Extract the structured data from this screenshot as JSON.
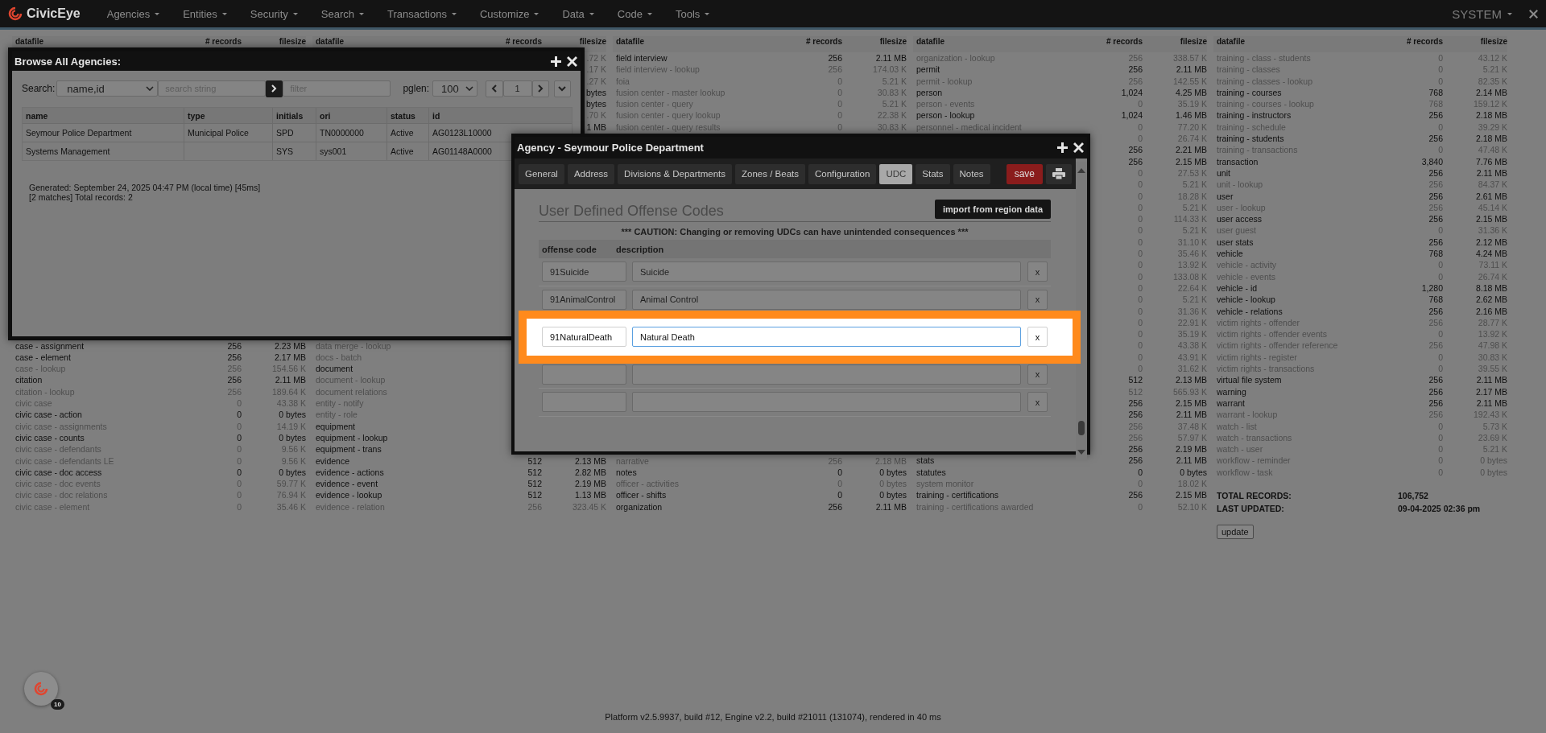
{
  "nav": {
    "logo": "CivicEye",
    "menus": [
      {
        "label": "Agencies"
      },
      {
        "label": "Entities"
      },
      {
        "label": "Security"
      },
      {
        "label": "Search"
      },
      {
        "label": "Transactions"
      },
      {
        "label": "Customize"
      },
      {
        "label": "Data"
      },
      {
        "label": "Code"
      },
      {
        "label": "Tools"
      }
    ],
    "user": "SYSTEM"
  },
  "datafile_columns": [
    {
      "kind": "partial",
      "headers": [
        "datafile",
        "# records",
        "filesize"
      ],
      "blocks": [
        {
          "rows": [
            {
              "datafile": "case - assignment",
              "records": "256",
              "filesize": "2.23 MB",
              "dim": false
            },
            {
              "datafile": "case - element",
              "records": "256",
              "filesize": "2.17 MB",
              "dim": false
            },
            {
              "datafile": "case - lookup",
              "records": "256",
              "filesize": "154.56 K",
              "dim": true
            },
            {
              "datafile": "citation",
              "records": "256",
              "filesize": "2.11 MB",
              "dim": false
            },
            {
              "datafile": "citation - lookup",
              "records": "256",
              "filesize": "189.64 K",
              "dim": true
            },
            {
              "datafile": "civic case",
              "records": "0",
              "filesize": "43.38 K",
              "dim": true
            },
            {
              "datafile": "civic case - action",
              "records": "0",
              "filesize": "0 bytes",
              "dim": false
            },
            {
              "datafile": "civic case - assignments",
              "records": "0",
              "filesize": "14.19 K",
              "dim": true
            },
            {
              "datafile": "civic case - counts",
              "records": "0",
              "filesize": "0 bytes",
              "dim": false
            },
            {
              "datafile": "civic case - defendants",
              "records": "0",
              "filesize": "9.56 K",
              "dim": true
            },
            {
              "datafile": "civic case - defendants LE",
              "records": "0",
              "filesize": "9.56 K",
              "dim": true
            },
            {
              "datafile": "civic case - doc access",
              "records": "0",
              "filesize": "0 bytes",
              "dim": false
            },
            {
              "datafile": "civic case - doc events",
              "records": "0",
              "filesize": "59.77 K",
              "dim": true
            },
            {
              "datafile": "civic case - doc relations",
              "records": "0",
              "filesize": "76.94 K",
              "dim": true
            },
            {
              "datafile": "civic case - element",
              "records": "0",
              "filesize": "35.46 K",
              "dim": true
            }
          ]
        }
      ]
    },
    {
      "kind": "partial",
      "headers": [
        "datafile",
        "# records",
        "filesize"
      ],
      "blocks": [
        {
          "rows": [
            {
              "filesize": ".72 K",
              "dim": true
            },
            {
              "filesize": ".17 K",
              "dim": true
            },
            {
              "filesize": ".27 K",
              "dim": true
            },
            {
              "filesize": "bytes",
              "dim": false
            },
            {
              "filesize": "bytes",
              "dim": false
            },
            {
              "filesize": ".70 K",
              "dim": true
            },
            {
              "filesize": "1 MB",
              "dim": false
            }
          ]
        },
        {
          "rows": [
            {
              "datafile": "data merge - lookup",
              "dim": true
            },
            {
              "datafile": "docs - batch",
              "dim": true
            },
            {
              "datafile": "document",
              "dim": false
            },
            {
              "datafile": "document - lookup",
              "dim": true
            },
            {
              "datafile": "document relations",
              "dim": true
            },
            {
              "datafile": "entity - notify",
              "dim": true
            },
            {
              "datafile": "entity - role",
              "dim": true
            },
            {
              "datafile": "equipment",
              "dim": false
            },
            {
              "datafile": "equipment - lookup",
              "dim": false
            },
            {
              "datafile": "equipment - trans",
              "dim": false
            },
            {
              "datafile": "evidence",
              "records": "512",
              "filesize": "2.13 MB",
              "dim": false
            },
            {
              "datafile": "evidence - actions",
              "records": "512",
              "filesize": "2.82 MB",
              "dim": false
            },
            {
              "datafile": "evidence - event",
              "records": "512",
              "filesize": "2.19 MB",
              "dim": false
            },
            {
              "datafile": "evidence - lookup",
              "records": "512",
              "filesize": "1.13 MB",
              "dim": false
            },
            {
              "datafile": "evidence - relation",
              "records": "256",
              "filesize": "323.45 K",
              "dim": true
            }
          ]
        }
      ]
    },
    {
      "kind": "partial",
      "headers": [
        "datafile",
        "# records",
        "filesize"
      ],
      "blocks": [
        {
          "rows": [
            {
              "datafile": "field interview",
              "records": "256",
              "filesize": "2.11 MB",
              "dim": false
            },
            {
              "datafile": "field interview - lookup",
              "records": "256",
              "filesize": "174.03 K",
              "dim": true
            },
            {
              "datafile": "foia",
              "records": "0",
              "filesize": "5.21 K",
              "dim": true
            },
            {
              "datafile": "fusion center - master lookup",
              "records": "0",
              "filesize": "30.83 K",
              "dim": true
            },
            {
              "datafile": "fusion center - query",
              "records": "0",
              "filesize": "5.21 K",
              "dim": true
            },
            {
              "datafile": "fusion center - query lookup",
              "records": "0",
              "filesize": "22.38 K",
              "dim": true
            },
            {
              "datafile": "fusion center - query results",
              "records": "0",
              "filesize": "30.83 K",
              "dim": true
            }
          ]
        },
        {
          "rows": [
            {
              "datafile": "narrative",
              "records": "256",
              "filesize": "2.18 MB",
              "dim": true
            },
            {
              "datafile": "notes",
              "records": "0",
              "filesize": "0 bytes",
              "dim": false
            },
            {
              "datafile": "officer - activities",
              "records": "0",
              "filesize": "0 bytes",
              "dim": true
            },
            {
              "datafile": "officer - shifts",
              "records": "0",
              "filesize": "0 bytes",
              "dim": false
            },
            {
              "datafile": "organization",
              "records": "256",
              "filesize": "2.11 MB",
              "dim": false
            }
          ]
        }
      ]
    },
    {
      "kind": "full",
      "headers": [
        "datafile",
        "# records",
        "filesize"
      ],
      "blocks": [
        {
          "rows": [
            {
              "datafile": "organization - lookup",
              "records": "256",
              "filesize": "338.57 K",
              "dim": true
            },
            {
              "datafile": "permit",
              "records": "256",
              "filesize": "2.11 MB",
              "dim": false
            },
            {
              "datafile": "permit - lookup",
              "records": "256",
              "filesize": "142.55 K",
              "dim": true
            },
            {
              "datafile": "person",
              "records": "1,024",
              "filesize": "4.25 MB",
              "dim": false
            },
            {
              "datafile": "person - events",
              "records": "0",
              "filesize": "35.19 K",
              "dim": true
            },
            {
              "datafile": "person - lookup",
              "records": "1,024",
              "filesize": "1.46 MB",
              "dim": false
            },
            {
              "datafile": "personnel - medical incident",
              "records": "0",
              "filesize": "77.20 K",
              "dim": true
            },
            {
              "records": "0",
              "filesize": "26.74 K",
              "dim": true
            },
            {
              "records": "256",
              "filesize": "2.21 MB",
              "dim": false
            },
            {
              "records": "256",
              "filesize": "2.15 MB",
              "dim": false
            },
            {
              "records": "0",
              "filesize": "27.53 K",
              "dim": true
            },
            {
              "records": "0",
              "filesize": "5.21 K",
              "dim": true
            },
            {
              "records": "0",
              "filesize": "18.28 K",
              "dim": true
            },
            {
              "records": "0",
              "filesize": "5.21 K",
              "dim": true
            },
            {
              "records": "0",
              "filesize": "114.33 K",
              "dim": true
            },
            {
              "records": "0",
              "filesize": "5.21 K",
              "dim": true
            },
            {
              "records": "0",
              "filesize": "31.10 K",
              "dim": true
            },
            {
              "records": "0",
              "filesize": "35.46 K",
              "dim": true
            },
            {
              "records": "0",
              "filesize": "13.92 K",
              "dim": true
            },
            {
              "records": "0",
              "filesize": "133.08 K",
              "dim": true
            },
            {
              "records": "0",
              "filesize": "22.64 K",
              "dim": true
            },
            {
              "records": "0",
              "filesize": "5.21 K",
              "dim": true
            },
            {
              "records": "0",
              "filesize": "31.36 K",
              "dim": true
            },
            {
              "records": "0",
              "filesize": "22.91 K",
              "dim": true
            },
            {
              "records": "0",
              "filesize": "35.19 K",
              "dim": true
            },
            {
              "records": "0",
              "filesize": "43.38 K",
              "dim": true
            },
            {
              "records": "0",
              "filesize": "43.91 K",
              "dim": true
            },
            {
              "records": "0",
              "filesize": "31.62 K",
              "dim": true
            },
            {
              "records": "512",
              "filesize": "2.13 MB",
              "dim": false
            },
            {
              "records": "512",
              "filesize": "565.93 K",
              "dim": true
            },
            {
              "records": "256",
              "filesize": "2.15 MB",
              "dim": false
            },
            {
              "records": "256",
              "filesize": "2.11 MB",
              "dim": false
            },
            {
              "records": "256",
              "filesize": "37.48 K",
              "dim": true
            },
            {
              "records": "256",
              "filesize": "57.97 K",
              "dim": true
            },
            {
              "records": "256",
              "filesize": "2.19 MB",
              "dim": false
            },
            {
              "datafile": "stats",
              "records": "256",
              "filesize": "2.11 MB",
              "dim": false
            },
            {
              "datafile": "statutes",
              "records": "0",
              "filesize": "0 bytes",
              "dim": false
            },
            {
              "datafile": "system monitor",
              "records": "0",
              "filesize": "18.02 K",
              "dim": true
            },
            {
              "datafile": "training - certifications",
              "records": "256",
              "filesize": "2.15 MB",
              "dim": false
            },
            {
              "datafile": "training - certifications awarded",
              "records": "0",
              "filesize": "52.10 K",
              "dim": true
            }
          ]
        }
      ]
    },
    {
      "kind": "full",
      "headers": [
        "datafile",
        "# records",
        "filesize"
      ],
      "blocks": [
        {
          "rows": [
            {
              "datafile": "training - class - students",
              "records": "0",
              "filesize": "43.12 K",
              "dim": true
            },
            {
              "datafile": "training - classes",
              "records": "0",
              "filesize": "5.21 K",
              "dim": true
            },
            {
              "datafile": "training - classes - lookup",
              "records": "0",
              "filesize": "82.35 K",
              "dim": true
            },
            {
              "datafile": "training - courses",
              "records": "768",
              "filesize": "2.14 MB",
              "dim": false
            },
            {
              "datafile": "training - courses - lookup",
              "records": "768",
              "filesize": "159.12 K",
              "dim": true
            },
            {
              "datafile": "training - instructors",
              "records": "256",
              "filesize": "2.18 MB",
              "dim": false
            },
            {
              "datafile": "training - schedule",
              "records": "0",
              "filesize": "39.29 K",
              "dim": true
            },
            {
              "datafile": "training - students",
              "records": "256",
              "filesize": "2.18 MB",
              "dim": false
            },
            {
              "datafile": "training - transactions",
              "records": "0",
              "filesize": "47.48 K",
              "dim": true
            },
            {
              "datafile": "transaction",
              "records": "3,840",
              "filesize": "7.76 MB",
              "dim": false
            },
            {
              "datafile": "unit",
              "records": "256",
              "filesize": "2.11 MB",
              "dim": false
            },
            {
              "datafile": "unit - lookup",
              "records": "256",
              "filesize": "84.37 K",
              "dim": true
            },
            {
              "datafile": "user",
              "records": "256",
              "filesize": "2.61 MB",
              "dim": false
            },
            {
              "datafile": "user - lookup",
              "records": "256",
              "filesize": "45.14 K",
              "dim": true
            },
            {
              "datafile": "user access",
              "records": "256",
              "filesize": "2.15 MB",
              "dim": false
            },
            {
              "datafile": "user guest",
              "records": "0",
              "filesize": "31.36 K",
              "dim": true
            },
            {
              "datafile": "user stats",
              "records": "256",
              "filesize": "2.12 MB",
              "dim": false
            },
            {
              "datafile": "vehicle",
              "records": "768",
              "filesize": "4.24 MB",
              "dim": false
            },
            {
              "datafile": "vehicle - activity",
              "records": "0",
              "filesize": "73.11 K",
              "dim": true
            },
            {
              "datafile": "vehicle - events",
              "records": "0",
              "filesize": "26.74 K",
              "dim": true
            },
            {
              "datafile": "vehicle - id",
              "records": "1,280",
              "filesize": "8.18 MB",
              "dim": false
            },
            {
              "datafile": "vehicle - lookup",
              "records": "768",
              "filesize": "2.62 MB",
              "dim": false
            },
            {
              "datafile": "vehicle - relations",
              "records": "256",
              "filesize": "2.16 MB",
              "dim": false
            },
            {
              "datafile": "victim rights - offender",
              "records": "256",
              "filesize": "28.77 K",
              "dim": true
            },
            {
              "datafile": "victim rights - offender events",
              "records": "0",
              "filesize": "13.92 K",
              "dim": true
            },
            {
              "datafile": "victim rights - offender reference",
              "records": "256",
              "filesize": "47.98 K",
              "dim": true
            },
            {
              "datafile": "victim rights - register",
              "records": "0",
              "filesize": "30.83 K",
              "dim": true
            },
            {
              "datafile": "victim rights - transactions",
              "records": "0",
              "filesize": "39.55 K",
              "dim": true
            },
            {
              "datafile": "virtual file system",
              "records": "256",
              "filesize": "2.11 MB",
              "dim": false
            },
            {
              "datafile": "warning",
              "records": "256",
              "filesize": "2.17 MB",
              "dim": false
            },
            {
              "datafile": "warrant",
              "records": "256",
              "filesize": "2.11 MB",
              "dim": false
            },
            {
              "datafile": "warrant - lookup",
              "records": "256",
              "filesize": "192.43 K",
              "dim": true
            },
            {
              "datafile": "watch - list",
              "records": "0",
              "filesize": "5.73 K",
              "dim": true
            },
            {
              "datafile": "watch - transactions",
              "records": "0",
              "filesize": "23.69 K",
              "dim": true
            },
            {
              "datafile": "watch - user",
              "records": "0",
              "filesize": "5.21 K",
              "dim": true
            },
            {
              "datafile": "workflow - reminder",
              "records": "0",
              "filesize": "0 bytes",
              "dim": true
            },
            {
              "datafile": "workflow - task",
              "records": "0",
              "filesize": "0 bytes",
              "dim": true
            }
          ]
        }
      ],
      "totals": [
        {
          "label": "TOTAL RECORDS:",
          "value": "106,752"
        },
        {
          "label": "LAST UPDATED:",
          "value": "09-04-2025 02:36 pm"
        }
      ],
      "update_button": "update"
    }
  ],
  "browse_dialog": {
    "title": "Browse All Agencies:",
    "search_label": "Search:",
    "search_by": "name,id",
    "search_placeholder": "search string",
    "filter_placeholder": "filter",
    "pglen_label": "pglen:",
    "pglen": "100",
    "page": "1",
    "columns": [
      "name",
      "type",
      "initials",
      "ori",
      "status",
      "id"
    ],
    "rows": [
      {
        "name": "Seymour Police Department",
        "type": "Municipal Police",
        "initials": "SPD",
        "ori": "TN0000000",
        "status": "Active",
        "id": "AG0123L10000"
      },
      {
        "name": "Systems Management",
        "initials": "SYS",
        "ori": "sys001",
        "status": "Active",
        "id": "AG01148A0000"
      }
    ],
    "generated": "Generated: September 24, 2025 04:47 PM (local time) [45ms]",
    "matches": "[2 matches] Total records: 2"
  },
  "agency_dialog": {
    "title": "Agency - Seymour Police Department",
    "tabs": [
      {
        "label": "General",
        "selected": false
      },
      {
        "label": "Address",
        "selected": false
      },
      {
        "label": "Divisions & Departments",
        "selected": false
      },
      {
        "label": "Zones / Beats",
        "selected": false
      },
      {
        "label": "Configuration",
        "selected": false
      },
      {
        "label": "UDC",
        "selected": true
      },
      {
        "label": "Stats",
        "selected": false
      },
      {
        "label": "Notes",
        "selected": false
      }
    ],
    "save": "save",
    "heading": "User Defined Offense Codes",
    "import_button": "import from region data",
    "caution": "*** CAUTION: Changing or removing UDCs can have unintended consequences ***",
    "columns": [
      "offense code",
      "description"
    ],
    "rows": [
      {
        "code": "91Suicide",
        "description": "Suicide",
        "delete": "x",
        "highlighted": false,
        "focused": false
      },
      {
        "code": "91AnimalControl",
        "description": "Animal Control",
        "delete": "x",
        "highlighted": false,
        "focused": false
      },
      {
        "code": "91NaturalDeath",
        "description": "Natural Death",
        "delete": "x",
        "highlighted": true,
        "focused": true
      },
      {
        "delete": "x",
        "highlighted": false,
        "focused": false
      },
      {
        "delete": "x",
        "highlighted": false,
        "focused": false
      }
    ]
  },
  "badge": {
    "count": "10"
  },
  "footer": "Platform v2.5.9937, build #12, Engine v2.2, build #21011 (131074), rendered in 40 ms"
}
